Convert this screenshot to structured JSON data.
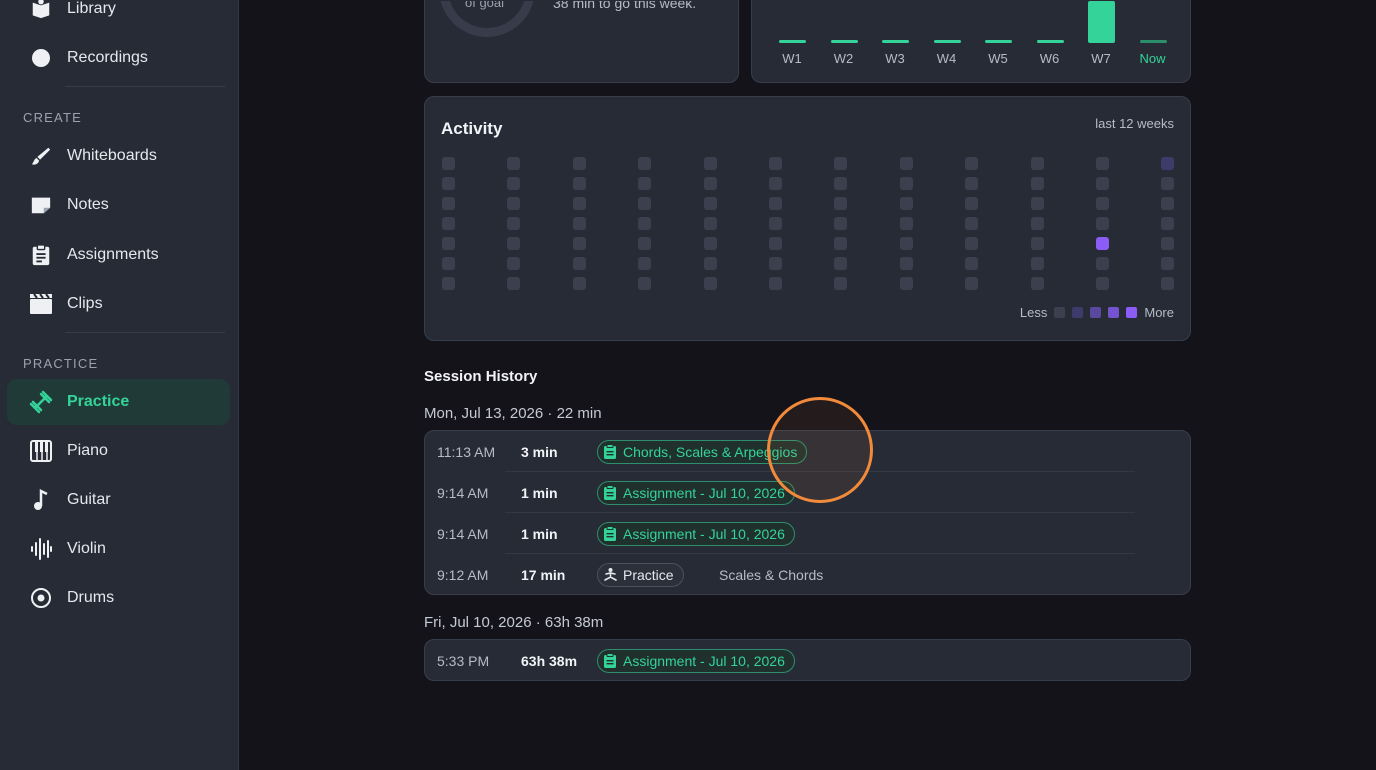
{
  "sidebar": {
    "items_top": [
      {
        "label": "Library",
        "icon": "book-icon"
      },
      {
        "label": "Recordings",
        "icon": "record-dot-icon"
      }
    ],
    "create_label": "CREATE",
    "create_items": [
      {
        "label": "Whiteboards",
        "icon": "brush-icon"
      },
      {
        "label": "Notes",
        "icon": "note-icon"
      },
      {
        "label": "Assignments",
        "icon": "clipboard-icon"
      },
      {
        "label": "Clips",
        "icon": "clapperboard-icon"
      }
    ],
    "practice_label": "PRACTICE",
    "practice_items": [
      {
        "label": "Practice",
        "icon": "dumbbell-icon",
        "active": true
      },
      {
        "label": "Piano",
        "icon": "piano-icon"
      },
      {
        "label": "Guitar",
        "icon": "music-note-icon"
      },
      {
        "label": "Violin",
        "icon": "waveform-icon"
      },
      {
        "label": "Drums",
        "icon": "drum-icon"
      }
    ]
  },
  "goal": {
    "donut_label": "of goal",
    "text": "38 min to go this week."
  },
  "weekly": {
    "weeks": [
      "W1",
      "W2",
      "W3",
      "W4",
      "W5",
      "W6",
      "W7",
      "Now"
    ],
    "current_label_color": "#34d399"
  },
  "activity": {
    "title": "Activity",
    "subtitle": "last 12 weeks",
    "legend_less": "Less",
    "legend_more": "More",
    "legend_colors": [
      "#3a404d",
      "#3e3a6a",
      "#5a479e",
      "#7353d0",
      "#8b5cf6"
    ]
  },
  "history": {
    "title": "Session History",
    "days": [
      {
        "header": "Mon, Jul 13, 2026 · 22 min",
        "sessions": [
          {
            "time": "11:13 AM",
            "duration": "3 min",
            "tag": "Chords, Scales & Arpeggios",
            "tag_type": "assignment",
            "note": ""
          },
          {
            "time": "9:14 AM",
            "duration": "1 min",
            "tag": "Assignment - Jul 10, 2026",
            "tag_type": "assignment",
            "note": ""
          },
          {
            "time": "9:14 AM",
            "duration": "1 min",
            "tag": "Assignment - Jul 10, 2026",
            "tag_type": "assignment",
            "note": ""
          },
          {
            "time": "9:12 AM",
            "duration": "17 min",
            "tag": "Practice",
            "tag_type": "practice",
            "note": "Scales & Chords"
          }
        ]
      },
      {
        "header": "Fri, Jul 10, 2026 · 63h 38m",
        "sessions": [
          {
            "time": "5:33 PM",
            "duration": "63h 38m",
            "tag": "Assignment - Jul 10, 2026",
            "tag_type": "assignment",
            "note": ""
          }
        ]
      }
    ]
  },
  "colors": {
    "accent": "#34d399",
    "activity_purple": "#8b5cf6",
    "cursor": "#f28a3c"
  }
}
